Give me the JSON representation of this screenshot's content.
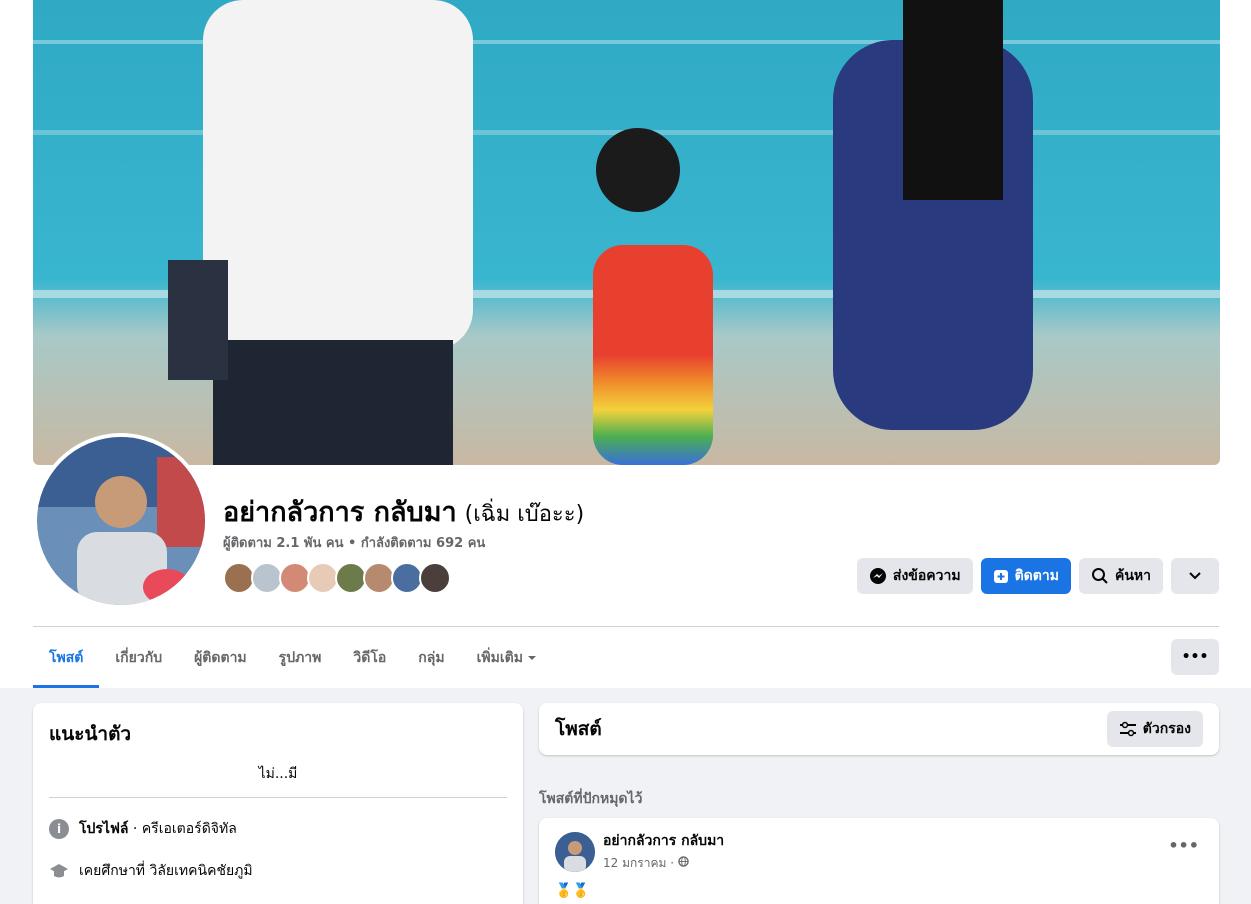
{
  "profile": {
    "name": "อย่ากลัวการ กลับมา",
    "alt_name": "(เฉิ่ม เบ๊อะะ)",
    "stats": "ผู้ติดตาม 2.1 พัน คน • กำลังติดตาม 692 คน"
  },
  "actions": {
    "message": "ส่งข้อความ",
    "follow": "ติดตาม",
    "search": "ค้นหา"
  },
  "tabs": [
    {
      "label": "โพสต์"
    },
    {
      "label": "เกี่ยวกับ"
    },
    {
      "label": "ผู้ติดตาม"
    },
    {
      "label": "รูปภาพ"
    },
    {
      "label": "วิดีโอ"
    },
    {
      "label": "กลุ่ม"
    },
    {
      "label": "เพิ่มเติม"
    }
  ],
  "more_dots": "•••",
  "intro": {
    "title": "แนะนำตัว",
    "bio": "ไม่...มี",
    "profile_label": "โปรไฟล์",
    "profile_value": " · ครีเอเตอร์ดิจิทัล",
    "education": "เคยศึกษาที่ วิลัยเทคนิคชัยภูมิ"
  },
  "posts": {
    "title": "โพสต์",
    "filter": "ตัวกรอง",
    "pinned_label": "โพสต์ที่ปักหมุดไว้",
    "items": [
      {
        "author": "อย่ากลัวการ กลับมา",
        "date": "12 มกราคม · ",
        "body": "🥇🥇"
      }
    ]
  },
  "colors": {
    "accent": "#1b74e4",
    "button_bg": "#e4e6eb",
    "muted": "#65676b"
  }
}
